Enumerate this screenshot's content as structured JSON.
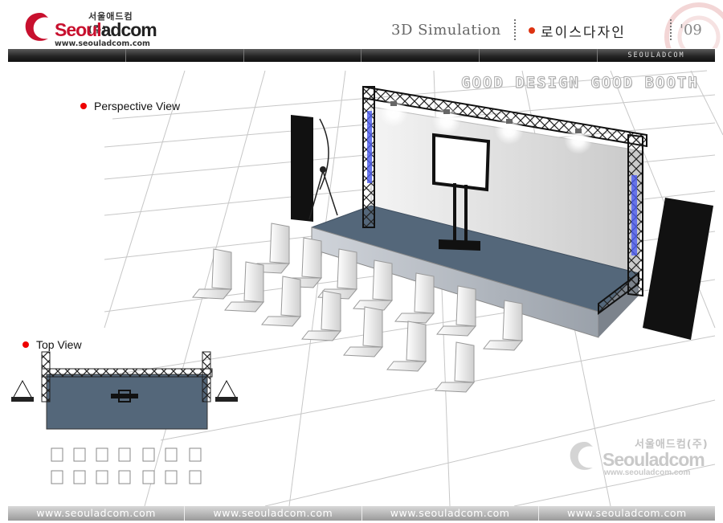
{
  "header": {
    "logo_korean": "서울애드컴(주)",
    "logo_name_red": "Seoul",
    "logo_name_dark": "adcom",
    "logo_url": "www.seouladcom.com",
    "title": "3D Simulation",
    "client": "로이스다자인",
    "year": "'09"
  },
  "navbar": {
    "segments": 5,
    "brand": "SEOULADCOM"
  },
  "slogan": "GOOD DESIGN GOOD BOOTH",
  "labels": {
    "perspective": "Perspective View",
    "top": "Top View"
  },
  "watermark": {
    "korean": "서울애드컴(주)",
    "name": "Seouladcom",
    "url": "www.seouladcom.com"
  },
  "footer": {
    "links": [
      "www.seouladcom.com",
      "www.seouladcom.com",
      "www.seouladcom.com",
      "www.seouladcom.com"
    ]
  },
  "colors": {
    "accent": "#d31111",
    "brand_red": "#c8102e",
    "stage_floor": "#54677a",
    "nav_dark": "#222222"
  }
}
